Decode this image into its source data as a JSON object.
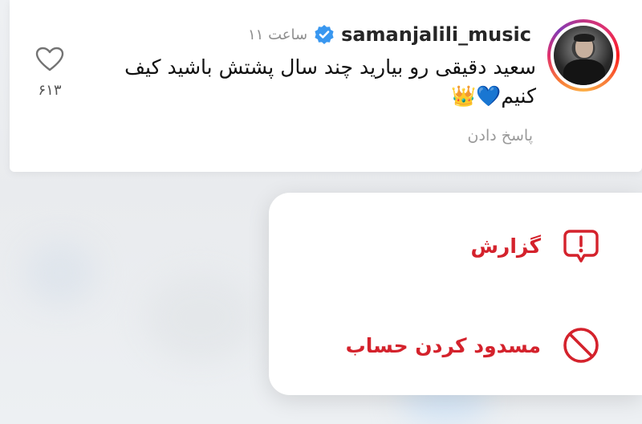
{
  "comment": {
    "username": "samanjalili_music",
    "time": "۱۱ ساعت",
    "text": "سعید دقیقی رو بیارید چند سال پشتش باشید کیف کنیم💙👑",
    "reply_label": "پاسخ دادن",
    "like_count": "۶۱۳",
    "verified_icon": "verified-badge-icon",
    "like_icon": "heart-outline-icon"
  },
  "menu": {
    "items": [
      {
        "label": "گزارش",
        "icon": "report-speech-bubble-icon",
        "color": "#d4222c"
      },
      {
        "label": "مسدود کردن حساب",
        "icon": "block-icon",
        "color": "#d4222c"
      }
    ]
  },
  "colors": {
    "accent_red": "#d4222c",
    "verified_blue": "#3897f0",
    "muted_text": "#8e8e8e"
  }
}
